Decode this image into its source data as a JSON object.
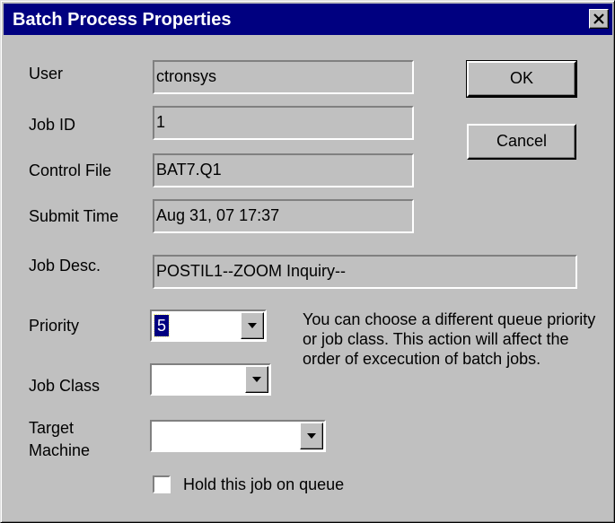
{
  "window": {
    "title": "Batch Process Properties"
  },
  "fields": {
    "user": {
      "label": "User",
      "value": "ctronsys"
    },
    "job_id": {
      "label": "Job ID",
      "value": "1"
    },
    "control_file": {
      "label": "Control File",
      "value": "BAT7.Q1"
    },
    "submit_time": {
      "label": "Submit Time",
      "value": "Aug 31, 07 17:37"
    },
    "job_desc": {
      "label": "Job Desc.",
      "value": "POSTIL1--ZOOM Inquiry--"
    }
  },
  "priority": {
    "label": "Priority",
    "value": "5"
  },
  "job_class": {
    "label": "Job Class",
    "value": ""
  },
  "target_machine": {
    "label_line1": "Target",
    "label_line2": "Machine",
    "value": ""
  },
  "help_text": "You can choose a different queue priority or job class. This action will affect the order of excecution of batch jobs.",
  "hold_checkbox": {
    "label": "Hold this job on queue",
    "checked": false
  },
  "buttons": {
    "ok": "OK",
    "cancel": "Cancel"
  },
  "icons": {
    "close": "close-icon",
    "dropdown": "chevron-down-icon"
  }
}
